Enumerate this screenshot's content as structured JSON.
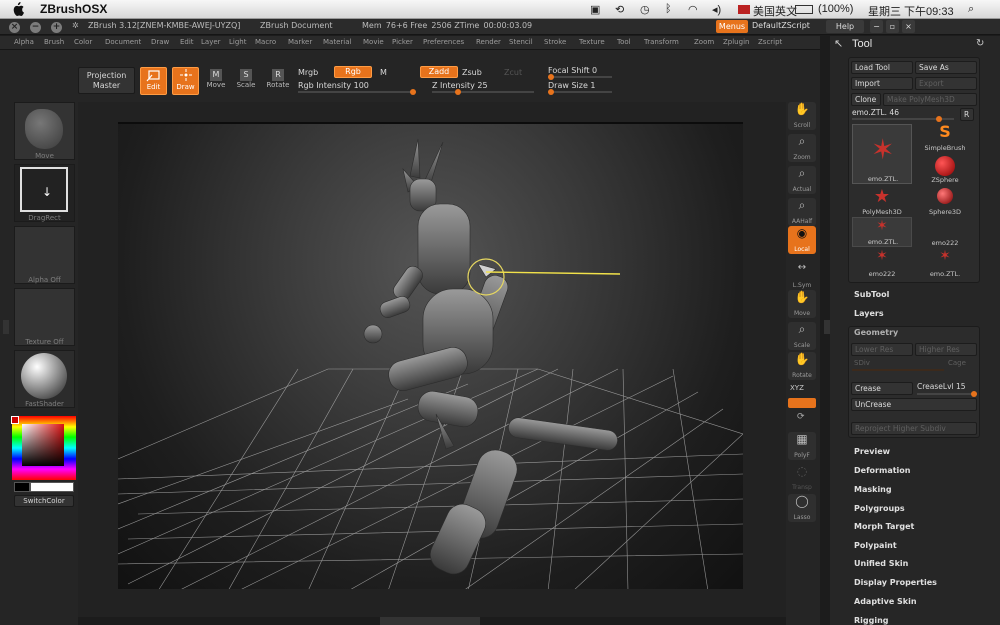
{
  "menubar": {
    "app_name": "ZBrushOSX",
    "battery": "(100%)",
    "input_method": "美国英文",
    "clock": "星期三 下午09:33"
  },
  "titlebar": {
    "version": "ZBrush 3.12[ZNEM-KMBE-AWEJ-UYZQ]",
    "document": "ZBrush Document",
    "mem": "Mem  76+6 Free  2506 ZTime  00:00:03.09",
    "menus": "Menus",
    "default_script": "DefaultZScript",
    "help": "Help"
  },
  "main_menu": [
    "Alpha",
    "Brush",
    "Color",
    "Document",
    "Draw",
    "Edit",
    "Layer",
    "Light",
    "Macro",
    "Marker",
    "Material",
    "Movie",
    "Picker",
    "Preferences",
    "Render",
    "Stencil",
    "Stroke",
    "Texture",
    "Tool",
    "Transform",
    "Zoom",
    "Zplugin",
    "Zscript"
  ],
  "shelf": {
    "projection_master": "Projection Master",
    "edit": "Edit",
    "draw": "Draw",
    "move": "Move",
    "scale": "Scale",
    "rotate": "Rotate",
    "mrgb": "Mrgb",
    "rgb": "Rgb",
    "m": "M",
    "zadd": "Zadd",
    "zsub": "Zsub",
    "zcut": "Zcut",
    "rgb_intensity": "Rgb Intensity 100",
    "z_intensity": "Z Intensity 25",
    "focal_shift": "Focal Shift 0",
    "draw_size": "Draw Size 1",
    "rgb_intensity_level": 1.0,
    "z_intensity_level": 0.25,
    "focal_shift_level": 0.0,
    "draw_size_level": 0.0
  },
  "left": {
    "brush": "Move",
    "stroke": "DragRect",
    "alpha": "Alpha Off",
    "texture": "Texture Off",
    "material": "FastShader",
    "switch_color": "SwitchColor"
  },
  "right_strip": {
    "scroll": "Scroll",
    "zoom": "Zoom",
    "actual": "Actual",
    "aahalf": "AAHalf",
    "local": "Local",
    "lsym": "L.Sym",
    "move": "Move",
    "scale": "Scale",
    "rotate": "Rotate",
    "xyz": "XYZ",
    "polyf": "PolyF",
    "transp": "Transp",
    "lasso": "Lasso"
  },
  "tool": {
    "title": "Tool",
    "load_tool": "Load Tool",
    "save_as": "Save As",
    "import": "Import",
    "export": "Export",
    "clone": "Clone",
    "make_polymesh": "Make PolyMesh3D",
    "current_tool": "emo.ZTL. 46",
    "current_tool_level": 0.85,
    "r": "R",
    "grid": [
      {
        "label": "emo.ZTL."
      },
      {
        "label": "SimpleBrush"
      },
      {
        "label": "ZSphere"
      },
      {
        "label": "PolyMesh3D"
      },
      {
        "label": "Sphere3D"
      },
      {
        "label": "emo.ZTL."
      },
      {
        "label": "emo222"
      },
      {
        "label": "emo222"
      },
      {
        "label": "emo.ZTL."
      }
    ],
    "subtool": "SubTool",
    "layers": "Layers",
    "geometry": "Geometry",
    "lower_res": "Lower Res",
    "higher_res": "Higher Res",
    "sdiv": "SDiv",
    "cage": "Cage",
    "crease": "Crease",
    "crease_lvl": "CreaseLvl 15",
    "crease_lvl_level": 1.0,
    "uncrease": "UnCrease",
    "reproject": "Reproject Higher Subdiv",
    "sections": [
      "Preview",
      "Deformation",
      "Masking",
      "Polygroups",
      "Morph Target",
      "Polypaint",
      "Unified Skin",
      "Display Properties",
      "Adaptive Skin",
      "Rigging"
    ]
  },
  "colors": {
    "accent": "#e7731c",
    "panel": "#262626"
  }
}
